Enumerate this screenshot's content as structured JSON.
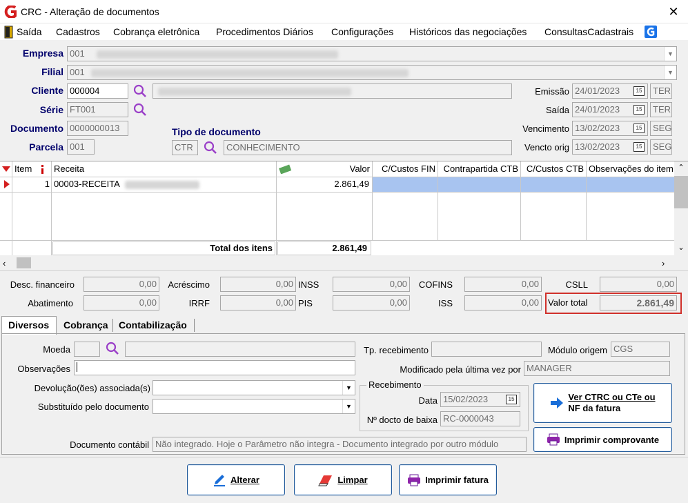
{
  "window": {
    "title": "CRC - Alteração de documentos",
    "close_glyph": "✕",
    "icon": "app-logo-icon"
  },
  "menu": {
    "items": [
      "Saída",
      "Cadastros",
      "Cobrança eletrônica",
      "Procedimentos Diários",
      "Configurações",
      "Históricos das negociações",
      "ConsultasCadastrais"
    ]
  },
  "header": {
    "empresa_label": "Empresa",
    "empresa_value": "001",
    "filial_label": "Filial",
    "filial_value": "001",
    "cliente_label": "Cliente",
    "cliente_value": "000004",
    "serie_label": "Série",
    "serie_value": "FT001",
    "documento_label": "Documento",
    "documento_value": "0000000013",
    "parcela_label": "Parcela",
    "parcela_value": "001",
    "tipo_label": "Tipo de documento",
    "tipo_code": "CTR",
    "tipo_desc": "CONHECIMENTO"
  },
  "dates": {
    "emissao_label": "Emissão",
    "emissao_value": "24/01/2023",
    "emissao_day": "TER",
    "saida_label": "Saída",
    "saida_value": "24/01/2023",
    "saida_day": "TER",
    "vencimento_label": "Vencimento",
    "vencimento_value": "13/02/2023",
    "vencimento_day": "SEG",
    "vencto_orig_label": "Vencto orig",
    "vencto_orig_value": "13/02/2023",
    "vencto_orig_day": "SEG",
    "cal_glyph": "15"
  },
  "grid": {
    "headers": {
      "item": "Item",
      "receita": "Receita",
      "valor": "Valor",
      "cc_fin": "C/Custos FIN",
      "contrapartida": "Contrapartida CTB",
      "cc_ctb": "C/Custos CTB",
      "obs": "Observações do item"
    },
    "rows": [
      {
        "item": "1",
        "receita": "00003-RECEITA",
        "valor": "2.861,49"
      }
    ],
    "total_label": "Total dos itens",
    "total_value": "2.861,49"
  },
  "totals": {
    "desc_fin_label": "Desc. financeiro",
    "desc_fin_value": "0,00",
    "acrescimo_label": "Acréscimo",
    "acrescimo_value": "0,00",
    "inss_label": "INSS",
    "inss_value": "0,00",
    "cofins_label": "COFINS",
    "cofins_value": "0,00",
    "csll_label": "CSLL",
    "csll_value": "0,00",
    "abatimento_label": "Abatimento",
    "abatimento_value": "0,00",
    "irrf_label": "IRRF",
    "irrf_value": "0,00",
    "pis_label": "PIS",
    "pis_value": "0,00",
    "iss_label": "ISS",
    "iss_value": "0,00",
    "valor_total_label": "Valor total",
    "valor_total_value": "2.861,49",
    "highlight_color": "#d0302a"
  },
  "tabs": [
    "Diversos",
    "Cobrança",
    "Contabilização"
  ],
  "diversos": {
    "moeda_label": "Moeda",
    "observacoes_label": "Observações",
    "devolucao_label": "Devolução(ões) associada(s)",
    "substituido_label": "Substituído pelo documento",
    "doc_contabil_label": "Documento contábil",
    "doc_contabil_value": "Não integrado. Hoje o Parâmetro não integra - Documento integrado por outro módulo",
    "tp_recebimento_label": "Tp. recebimento",
    "modulo_origem_label": "Módulo origem",
    "modulo_origem_value": "CGS",
    "modificado_label": "Modificado pela última vez por",
    "modificado_value": "MANAGER",
    "recebimento_group": "Recebimento",
    "data_label": "Data",
    "data_value": "15/02/2023",
    "docto_baixa_label": "Nº docto de baixa",
    "docto_baixa_value": "RC-0000043",
    "ver_ctrc_line1": "Ver CTRC ou CTe ou",
    "ver_ctrc_line2": "NF da fatura",
    "imprimir_comprovante": "Imprimir comprovante"
  },
  "footer": {
    "alterar": "Alterar",
    "limpar": "Limpar",
    "imprimir_fatura": "Imprimir fatura"
  },
  "colors": {
    "accent": "#00006b",
    "selection": "#a8c4f0",
    "button_border": "#225a9a"
  }
}
